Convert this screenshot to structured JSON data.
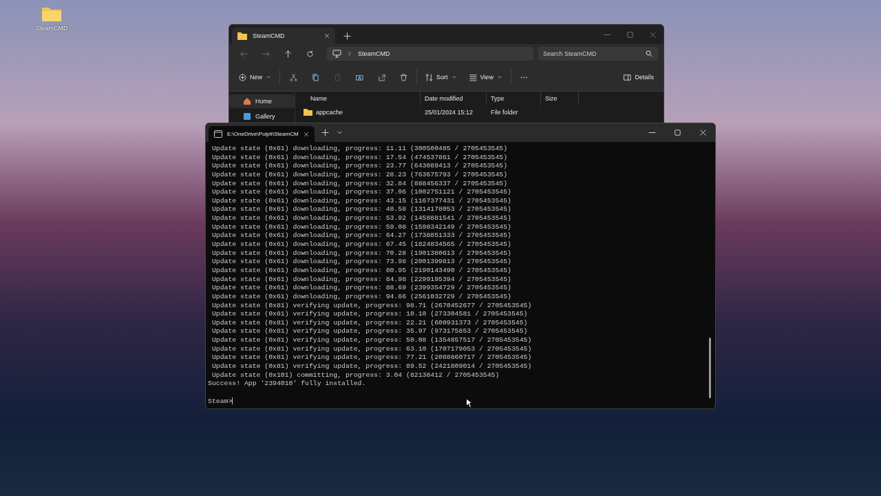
{
  "desktop_icons": [
    {
      "label": "SteamCMD"
    }
  ],
  "explorer": {
    "tabs": [
      {
        "label": "SteamCMD",
        "selected": true
      }
    ],
    "address": {
      "crumb": "SteamCMD"
    },
    "search": {
      "placeholder": "Search SteamCMD"
    },
    "toolbar": {
      "new": "New",
      "sort": "Sort",
      "view": "View",
      "details": "Details"
    },
    "sidebar": [
      {
        "label": "Home",
        "selected": true
      },
      {
        "label": "Gallery",
        "selected": false
      }
    ],
    "columns": [
      "Name",
      "Date modified",
      "Type",
      "Size"
    ],
    "rows": [
      {
        "name": "appcache",
        "date": "25/01/2024 15:12",
        "type": "File folder"
      }
    ]
  },
  "terminal": {
    "tabs": [
      {
        "label": "E:\\OneDrive\\Pulpit\\SteamCM",
        "selected": true
      }
    ],
    "lines": [
      " Update state (0x61) downloading, progress: 11.11 (300500485 / 2705453545)",
      " Update state (0x61) downloading, progress: 17.54 (474537861 / 2705453545)",
      " Update state (0x61) downloading, progress: 23.77 (643089413 / 2705453545)",
      " Update state (0x61) downloading, progress: 28.23 (763675793 / 2705453545)",
      " Update state (0x61) downloading, progress: 32.84 (888456337 / 2705453545)",
      " Update state (0x61) downloading, progress: 37.06 (1002751121 / 2705453545)",
      " Update state (0x61) downloading, progress: 43.15 (1167377431 / 2705453545)",
      " Update state (0x61) downloading, progress: 48.58 (1314178053 / 2705453545)",
      " Update state (0x61) downloading, progress: 53.92 (1458881541 / 2705453545)",
      " Update state (0x61) downloading, progress: 59.08 (1598342149 / 2705453545)",
      " Update state (0x61) downloading, progress: 64.27 (1738851333 / 2705453545)",
      " Update state (0x61) downloading, progress: 67.45 (1824834565 / 2705453545)",
      " Update state (0x61) downloading, progress: 70.28 (1901380613 / 2705453545)",
      " Update state (0x61) downloading, progress: 73.98 (2001399813 / 2705453545)",
      " Update state (0x61) downloading, progress: 80.95 (2190143490 / 2705453545)",
      " Update state (0x61) downloading, progress: 84.98 (2299195394 / 2705453545)",
      " Update state (0x61) downloading, progress: 88.69 (2399354729 / 2705453545)",
      " Update state (0x61) downloading, progress: 94.66 (2561032729 / 2705453545)",
      " Update state (0x81) verifying update, progress: 98.71 (2670452677 / 2705453545)",
      " Update state (0x81) verifying update, progress: 10.10 (273304581 / 2705453545)",
      " Update state (0x81) verifying update, progress: 22.21 (600931373 / 2705453545)",
      " Update state (0x81) verifying update, progress: 35.97 (973175853 / 2705453545)",
      " Update state (0x81) verifying update, progress: 50.08 (1354857517 / 2705453545)",
      " Update state (0x81) verifying update, progress: 63.10 (1707179053 / 2705453545)",
      " Update state (0x81) verifying update, progress: 77.21 (2088860717 / 2705453545)",
      " Update state (0x81) verifying update, progress: 89.52 (2421809014 / 2705453545)",
      " Update state (0x101) committing, progress: 3.04 (82138412 / 2705453545)",
      "Success! App '2394010' fully installed."
    ],
    "prompt": "Steam>"
  }
}
